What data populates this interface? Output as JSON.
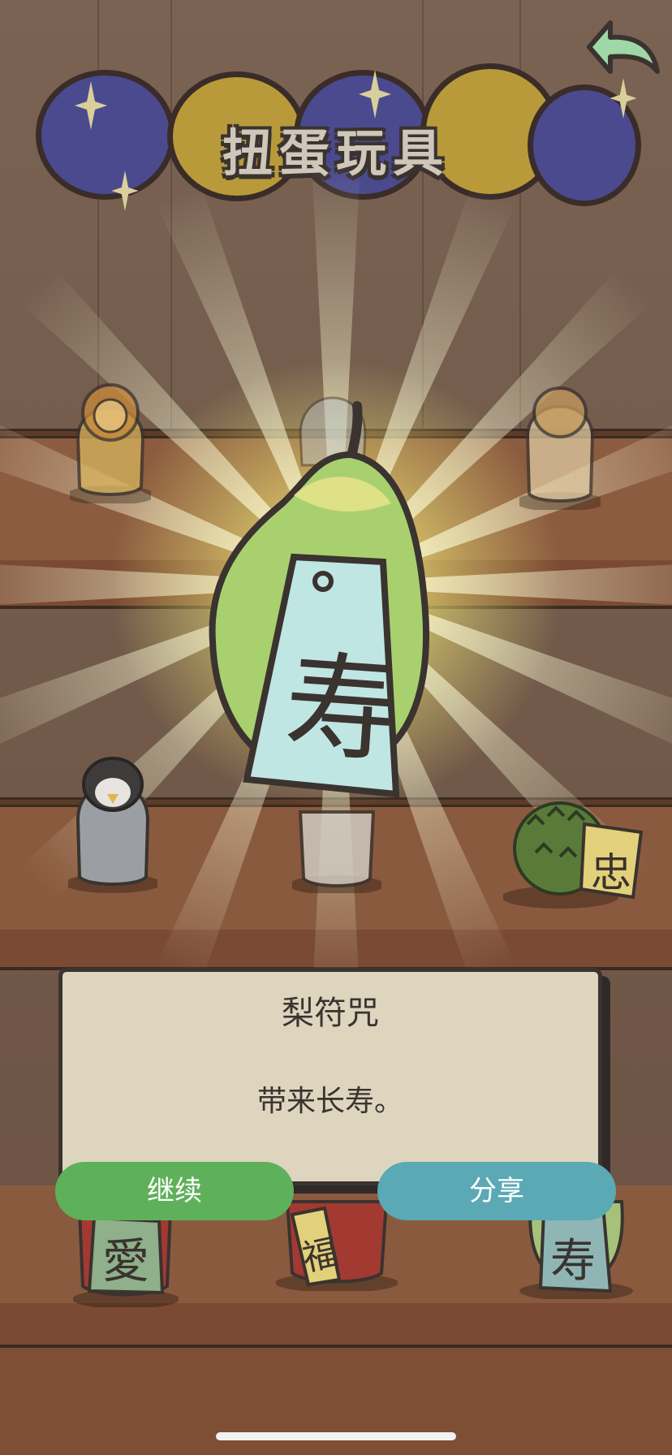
{
  "header": {
    "title": "扭蛋玩具",
    "back_icon": "back-arrow-icon"
  },
  "reveal": {
    "item_name": "梨符咒",
    "item_description": "带来长寿。",
    "charm_character": "寿"
  },
  "shelf_items": {
    "durian_tag": "忠",
    "apple_tag_left": "愛",
    "apple_tag_middle": "福",
    "pear_tag_right": "寿"
  },
  "actions": {
    "continue_label": "继续",
    "share_label": "分享"
  },
  "colors": {
    "continue_button": "#5fb05a",
    "share_button": "#5aa9b4",
    "dialog_bg": "#ddd5bd",
    "outline": "#3a332f",
    "shelf_wood": "#7a4a32"
  }
}
